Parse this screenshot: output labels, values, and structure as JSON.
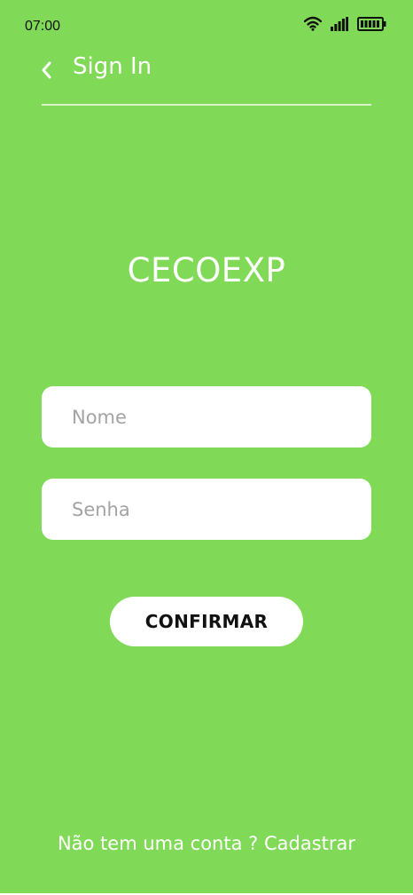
{
  "status_bar": {
    "time": "07:00",
    "icons": [
      "wifi-icon",
      "signal-icon",
      "battery-icon"
    ]
  },
  "header": {
    "back_icon": "chevron-left-icon",
    "title": "Sign In"
  },
  "app": {
    "title": "CECOEXP"
  },
  "form": {
    "name_placeholder": "Nome",
    "name_value": "",
    "password_placeholder": "Senha",
    "password_value": "",
    "confirm_label": "CONFIRMAR"
  },
  "footer": {
    "prompt": "Não tem uma conta ?",
    "link": "Cadastrar"
  },
  "colors": {
    "background": "#80da58",
    "text": "#ffffff",
    "input_bg": "#ffffff",
    "button_text": "#111111"
  }
}
